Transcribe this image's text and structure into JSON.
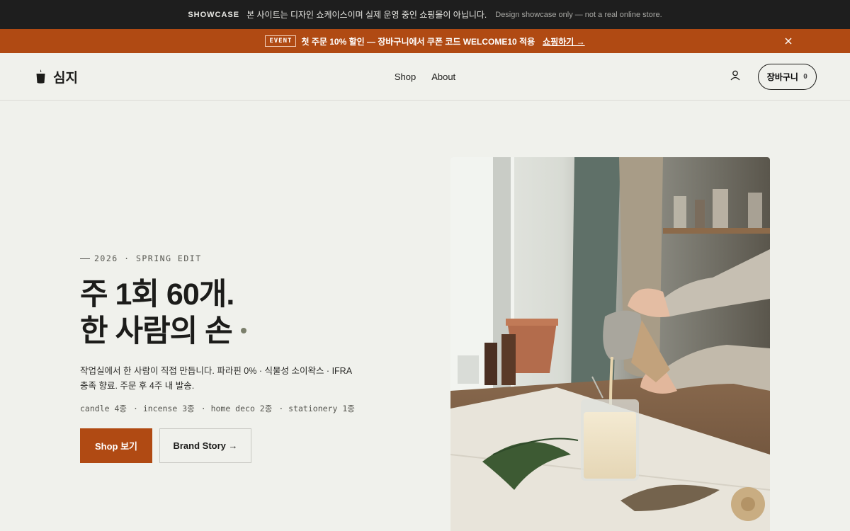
{
  "showcase": {
    "tag": "SHOWCASE",
    "text_ko": "본 사이트는 디자인 쇼케이스이며 실제 운영 중인 쇼핑몰이 아닙니다.",
    "text_en": "Design showcase only — not a real online store."
  },
  "event": {
    "badge": "EVENT",
    "text": "첫 주문 10% 할인 — 장바구니에서 쿠폰 코드 WELCOME10 적용",
    "link": "쇼핑하기 →",
    "close_icon": "close-icon"
  },
  "header": {
    "logo": "심지",
    "nav": [
      "Shop",
      "About"
    ],
    "cart_label": "장바구니",
    "cart_count": "0",
    "user_icon": "user-icon"
  },
  "hero": {
    "eyebrow": "2026 · SPRING EDIT",
    "headline_line1": "주 1회 60개.",
    "headline_line2": "한 사람의 손",
    "description": "작업실에서 한 사람이 직접 만듭니다. 파라핀 0% · 식물성 소이왁스 · IFRA 충족 향료. 주문 후 4주 내 발송.",
    "tags": [
      "candle 4종",
      "· incense 3종",
      "· home deco 2종",
      "· stationery 1종"
    ],
    "primary_button": "Shop 보기",
    "secondary_button": "Brand Story →"
  },
  "colors": {
    "accent": "#b04a13",
    "background": "#f0f1ec",
    "dark_bar": "#1e1e1e"
  }
}
